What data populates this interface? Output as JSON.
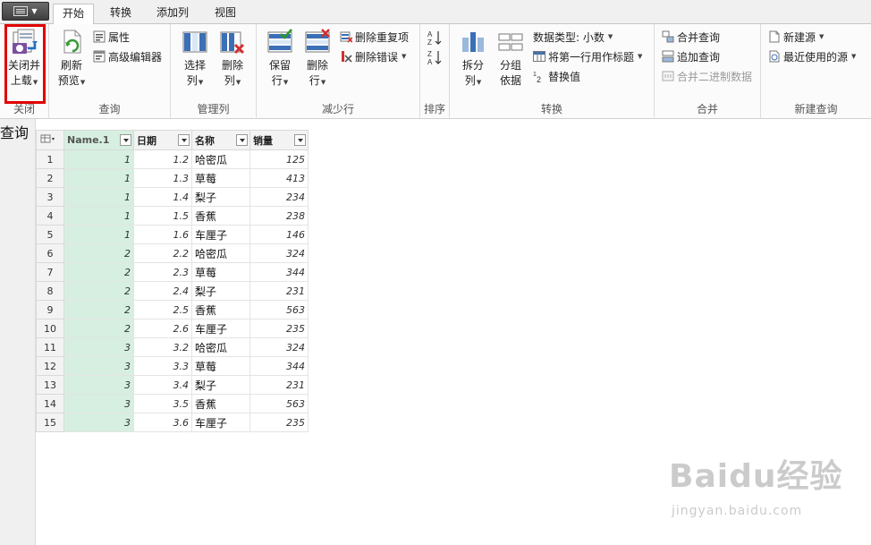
{
  "file_button": {
    "icon": "app-menu-icon"
  },
  "tabs": [
    {
      "label": "开始",
      "active": true
    },
    {
      "label": "转换",
      "active": false
    },
    {
      "label": "添加列",
      "active": false
    },
    {
      "label": "视图",
      "active": false
    }
  ],
  "ribbon": {
    "close_group": {
      "label": "关闭",
      "close_load_line1": "关闭并",
      "close_load_line2": "上载"
    },
    "query_group": {
      "label": "查询",
      "refresh_line1": "刷新",
      "refresh_line2": "预览",
      "properties": "属性",
      "advanced_editor": "高级编辑器"
    },
    "manage_cols_group": {
      "label": "管理列",
      "choose_line1": "选择",
      "choose_line2": "列",
      "remove_line1": "删除",
      "remove_line2": "列"
    },
    "reduce_rows_group": {
      "label": "减少行",
      "keep_line1": "保留",
      "keep_line2": "行",
      "remove_line1": "删除",
      "remove_line2": "行",
      "remove_duplicates": "删除重复项",
      "remove_errors": "删除错误"
    },
    "sort_group": {
      "label": "排序"
    },
    "transform_group": {
      "label": "转换",
      "split_line1": "拆分",
      "split_line2": "列",
      "group_line1": "分组",
      "group_line2": "依据",
      "data_type": "数据类型: 小数",
      "first_row_headers": "将第一行用作标题",
      "replace_values": "替换值"
    },
    "combine_group": {
      "label": "合并",
      "merge_queries": "合并查询",
      "append_queries": "追加查询",
      "combine_binaries": "合并二进制数据"
    },
    "new_query_group": {
      "label": "新建查询",
      "new_source": "新建源",
      "recent_sources": "最近使用的源"
    }
  },
  "query_pane": {
    "label": "查询"
  },
  "table": {
    "columns": [
      "Name.1",
      "日期",
      "名称",
      "销量"
    ],
    "rows": [
      [
        "1",
        "1.2",
        "哈密瓜",
        "125"
      ],
      [
        "1",
        "1.3",
        "草莓",
        "413"
      ],
      [
        "1",
        "1.4",
        "梨子",
        "234"
      ],
      [
        "1",
        "1.5",
        "香蕉",
        "238"
      ],
      [
        "1",
        "1.6",
        "车厘子",
        "146"
      ],
      [
        "2",
        "2.2",
        "哈密瓜",
        "324"
      ],
      [
        "2",
        "2.3",
        "草莓",
        "344"
      ],
      [
        "2",
        "2.4",
        "梨子",
        "231"
      ],
      [
        "2",
        "2.5",
        "香蕉",
        "563"
      ],
      [
        "2",
        "2.6",
        "车厘子",
        "235"
      ],
      [
        "3",
        "3.2",
        "哈密瓜",
        "324"
      ],
      [
        "3",
        "3.3",
        "草莓",
        "344"
      ],
      [
        "3",
        "3.4",
        "梨子",
        "231"
      ],
      [
        "3",
        "3.5",
        "香蕉",
        "563"
      ],
      [
        "3",
        "3.6",
        "车厘子",
        "235"
      ]
    ]
  },
  "watermark": {
    "brand": "Baidu经验",
    "url": "jingyan.baidu.com"
  },
  "colors": {
    "highlight": "#e00000",
    "selected_column": "#d6efe1",
    "ribbon_bg": "#fbfbfb"
  }
}
